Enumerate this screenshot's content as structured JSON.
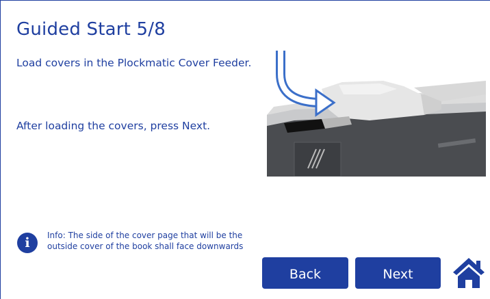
{
  "header": {
    "title": "Guided Start 5/8"
  },
  "instructions": {
    "line1": "Load covers in the Plockmatic Cover Feeder.",
    "line2": "After loading the covers, press Next."
  },
  "info": {
    "icon": "info-icon",
    "text": "Info: The side of the cover page that will be the outside cover of the book shall face downwards"
  },
  "buttons": {
    "back_label": "Back",
    "next_label": "Next"
  },
  "icons": {
    "home": "home-icon"
  },
  "colors": {
    "accent": "#1f3fa0",
    "background": "#ffffff",
    "arrow": "#3b6fc9"
  }
}
